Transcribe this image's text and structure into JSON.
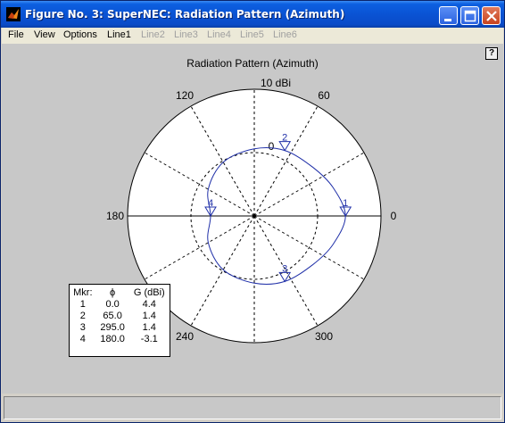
{
  "window": {
    "title": "Figure No. 3: SuperNEC: Radiation Pattern (Azimuth)"
  },
  "menu": {
    "file": "File",
    "view": "View",
    "options": "Options",
    "line1": "Line1",
    "line2": "Line2",
    "line3": "Line3",
    "line4": "Line4",
    "line5": "Line5",
    "line6": "Line6"
  },
  "help_label": "?",
  "chart_data": {
    "type": "polar-line",
    "title": "Radiation Pattern (Azimuth)",
    "radial_max_label": "10 dBi",
    "radial_inner_label": "0",
    "angle_tick_labels": [
      "0",
      "60",
      "120",
      "180",
      "240",
      "300"
    ],
    "series": [
      {
        "name": "Line1",
        "color": "#1f2fa8",
        "angles_deg": [
          0,
          20,
          40,
          65,
          90,
          120,
          150,
          180,
          210,
          240,
          270,
          295,
          320,
          340
        ],
        "values": [
          4.4,
          3.2,
          2.0,
          1.4,
          0.6,
          -0.2,
          -1.6,
          -3.1,
          -1.6,
          -0.2,
          0.6,
          1.4,
          2.0,
          3.2
        ]
      }
    ],
    "markers": [
      {
        "id": "1",
        "phi": 0.0,
        "gain": 4.4
      },
      {
        "id": "2",
        "phi": 65.0,
        "gain": 1.4
      },
      {
        "id": "3",
        "phi": 295.0,
        "gain": 1.4
      },
      {
        "id": "4",
        "phi": 180.0,
        "gain": -3.1
      }
    ]
  },
  "marker_table": {
    "headers": [
      "Mkr:",
      "ϕ",
      "G (dBi)"
    ],
    "rows": [
      [
        "1",
        "0.0",
        "4.4"
      ],
      [
        "2",
        "65.0",
        "1.4"
      ],
      [
        "3",
        "295.0",
        "1.4"
      ],
      [
        "4",
        "180.0",
        "-3.1"
      ]
    ]
  }
}
